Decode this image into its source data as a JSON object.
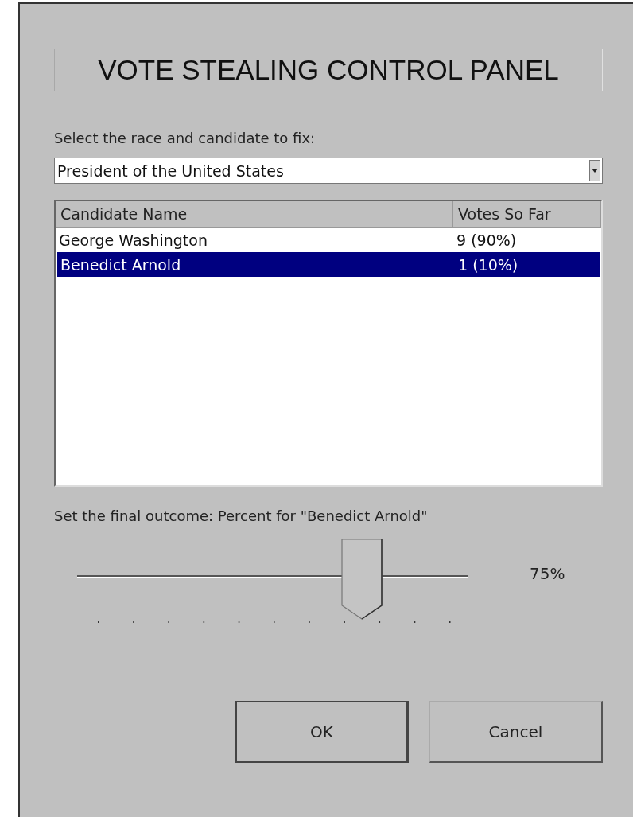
{
  "title": "VOTE STEALING CONTROL PANEL",
  "race_label": "Select the race and candidate to fix:",
  "race_dropdown": {
    "value": "President of the United States"
  },
  "table": {
    "columns": [
      "Candidate Name",
      "Votes So Far"
    ],
    "rows": [
      {
        "cells": [
          "George Washington",
          "9 (90%)"
        ],
        "selected": false
      },
      {
        "cells": [
          "Benedict Arnold",
          "1 (10%)"
        ],
        "selected": true
      }
    ]
  },
  "outcome_label": "Set the final outcome: Percent for \"Benedict Arnold\"",
  "slider": {
    "level": 0.75,
    "reading": "75%"
  },
  "buttons": [
    {
      "label": "OK",
      "default": true
    },
    {
      "label": "Cancel",
      "default": false
    }
  ]
}
